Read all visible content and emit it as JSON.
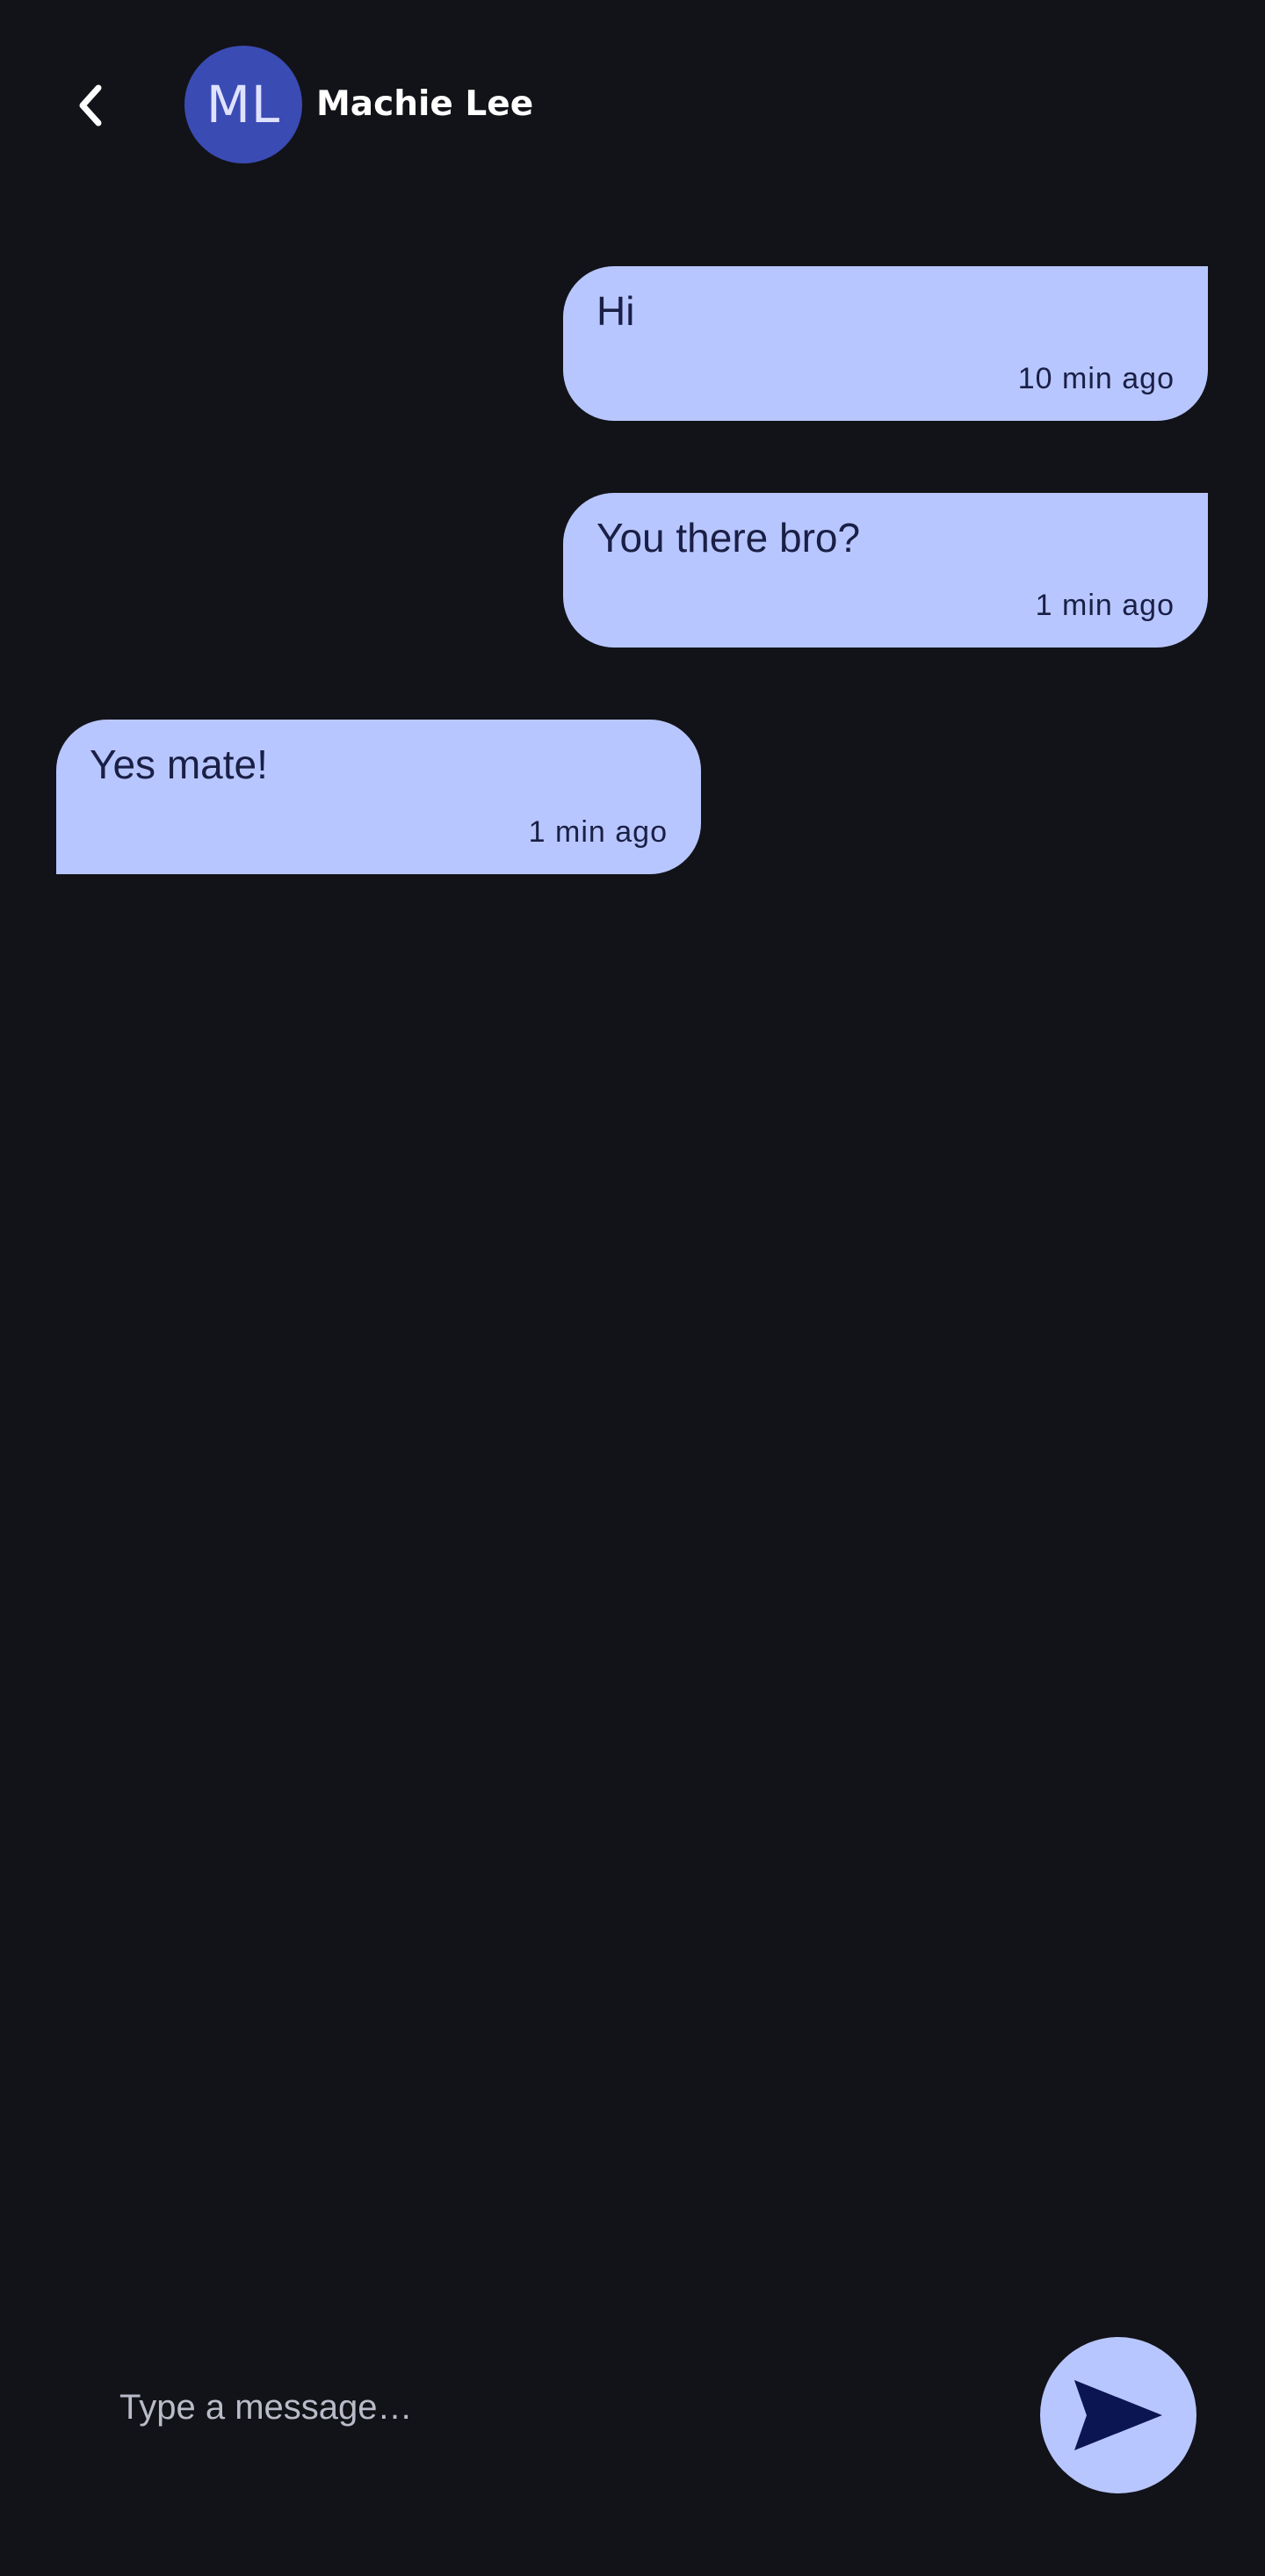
{
  "header": {
    "back_icon": "chevron-left-icon",
    "avatar_initials": "ML",
    "contact_name": "Machie Lee"
  },
  "messages": [
    {
      "direction": "sent",
      "text": "Hi",
      "time": "10 min ago"
    },
    {
      "direction": "sent",
      "text": "You there bro?",
      "time": "1 min ago"
    },
    {
      "direction": "received",
      "text": "Yes mate!",
      "time": "1 min ago"
    }
  ],
  "composer": {
    "placeholder": "Type a message…",
    "value": "",
    "send_icon": "send-icon"
  },
  "colors": {
    "background": "#121318",
    "bubble": "#b8c6ff",
    "bubble_text": "#1a1f45",
    "avatar": "#3b4bb4",
    "send_icon": "#0b1552"
  }
}
